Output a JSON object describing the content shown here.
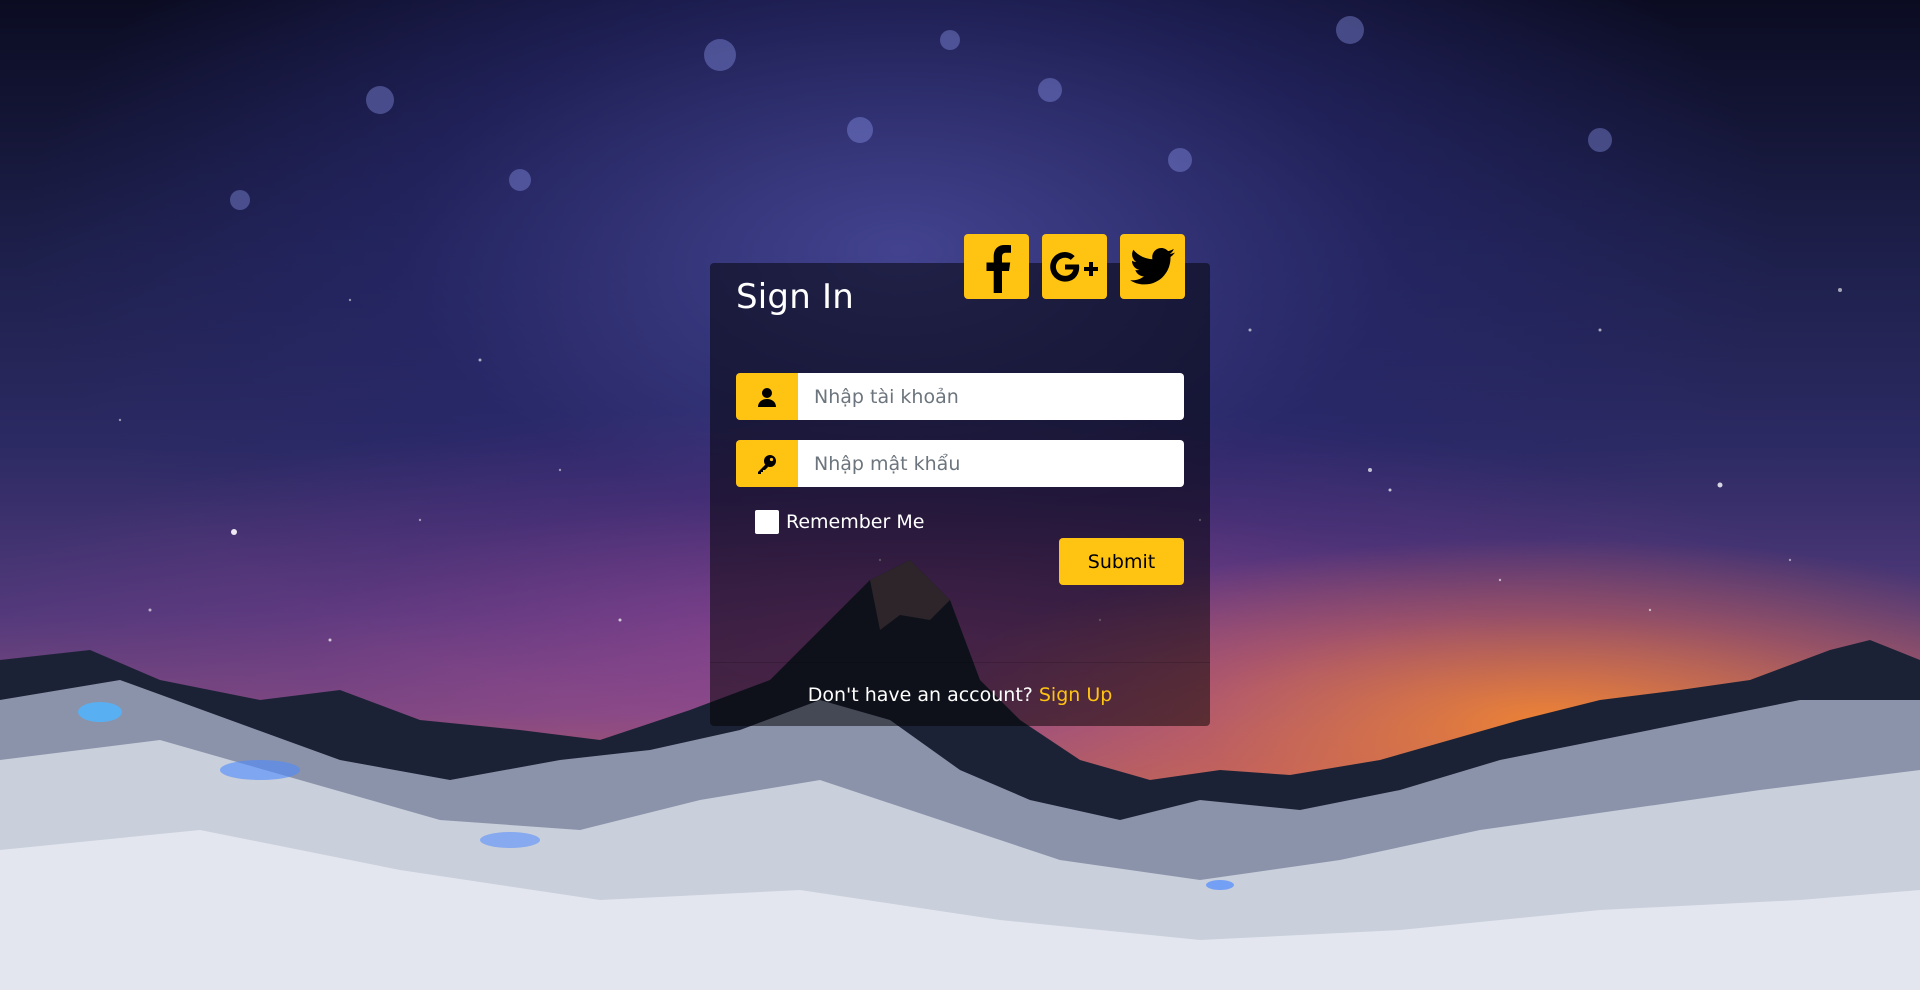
{
  "login": {
    "title": "Sign In",
    "username_placeholder": "Nhập tài khoản",
    "password_placeholder": "Nhập mật khẩu",
    "remember_label": "Remember Me",
    "submit_label": "Submit",
    "footer_text": "Don't have an account?",
    "signup_label": "Sign Up"
  },
  "social": [
    {
      "icon": "facebook-icon"
    },
    {
      "icon": "google-plus-icon"
    },
    {
      "icon": "twitter-icon"
    }
  ],
  "colors": {
    "accent": "#FFC312",
    "card_bg": "rgba(0,0,0,0.5)",
    "text": "#ffffff"
  }
}
